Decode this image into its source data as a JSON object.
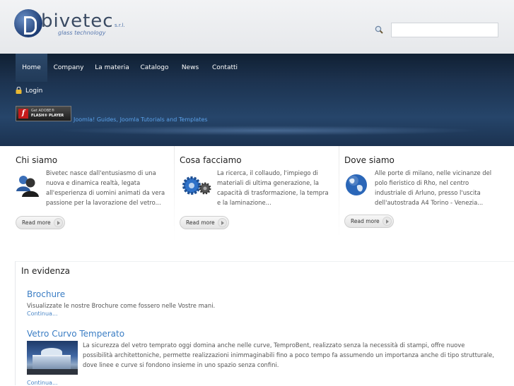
{
  "header": {
    "logo": {
      "name": "bivetec",
      "suffix": "s.r.l.",
      "tagline": "glass technology"
    },
    "search": {
      "placeholder": ""
    }
  },
  "nav": {
    "items": [
      {
        "label": "Home",
        "active": true
      },
      {
        "label": "Company",
        "active": false
      },
      {
        "label": "La materia",
        "active": false
      },
      {
        "label": "Catalogo",
        "active": false
      },
      {
        "label": "News",
        "active": false
      },
      {
        "label": "Contatti",
        "active": false
      }
    ]
  },
  "banner": {
    "login_label": "Login",
    "flash_badge": {
      "line1": "Get ADOBE®",
      "line2": "FLASH® PLAYER"
    },
    "joomla_link": "Joomla! Guides, Joomla Tutorials and Templates"
  },
  "columns": [
    {
      "title": "Chi siamo",
      "icon": "users-icon",
      "text": "Bivetec nasce dall'entusiasmo di una nuova e dinamica realtà, legata all'esperienza di uomini animati da vera passione per la lavorazione del vetro...",
      "button": "Read more"
    },
    {
      "title": "Cosa facciamo",
      "icon": "gears-icon",
      "text": "La ricerca, il collaudo, l'impiego di materiali di ultima generazione, la capacità di trasformazione, la tempra e la laminazione...",
      "button": "Read more"
    },
    {
      "title": "Dove siamo",
      "icon": "globe-icon",
      "text": "Alle porte di milano, nelle vicinanze del polo fieristico di Rho, nel centro industriale di Arluno, presso l'uscita dell'autostrada A4 Torino - Venezia...",
      "button": "Read more"
    }
  ],
  "evidence": {
    "title": "In evidenza",
    "articles": [
      {
        "title": "Brochure",
        "text": "Visualizzate le nostre Brochure come fossero nelle Vostre mani.",
        "link": "Continua..."
      },
      {
        "title": "Vetro Curvo Temperato",
        "text": "La sicurezza del vetro temprato oggi domina anche nelle curve, TemproBent, realizzato senza la necessità di stampi, offre nuove possibilità architettoniche, permette realizzazioni inimmaginabili fino a poco tempo fa assumendo un importanza anche di tipo strutturale, dove linee e curve si fondono insieme in uno spazio senza confini.",
        "link": "Continua..."
      }
    ]
  },
  "colors": {
    "nav_bg": "#102033",
    "banner_bg": "#26456a",
    "link_blue": "#3a7dc4",
    "header_bg": "#eceef0"
  }
}
